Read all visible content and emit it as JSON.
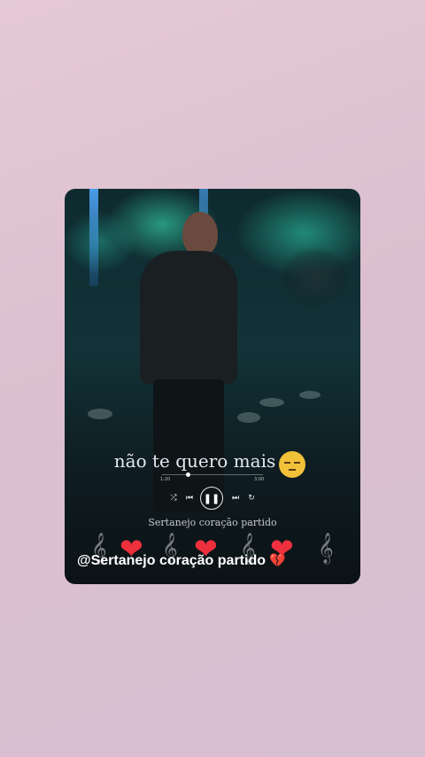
{
  "story": {
    "lyric_line": "não te quero mais",
    "emoji": "pensive-face",
    "player": {
      "elapsed": "1:20",
      "total": "3:00",
      "progress": 0.25
    },
    "song_subtitle": "Sertanejo coração partido",
    "username_tag": "@Sertanejo coração partido",
    "decorations": {
      "hearts": [
        "red-heart",
        "red-heart",
        "red-heart"
      ],
      "broken_heart": "broken-heart",
      "note_symbol": "𝄞"
    },
    "colors": {
      "background": "#e2c7d4",
      "heart": "#ee2f3c",
      "stage_light": "#38d2aa"
    }
  }
}
